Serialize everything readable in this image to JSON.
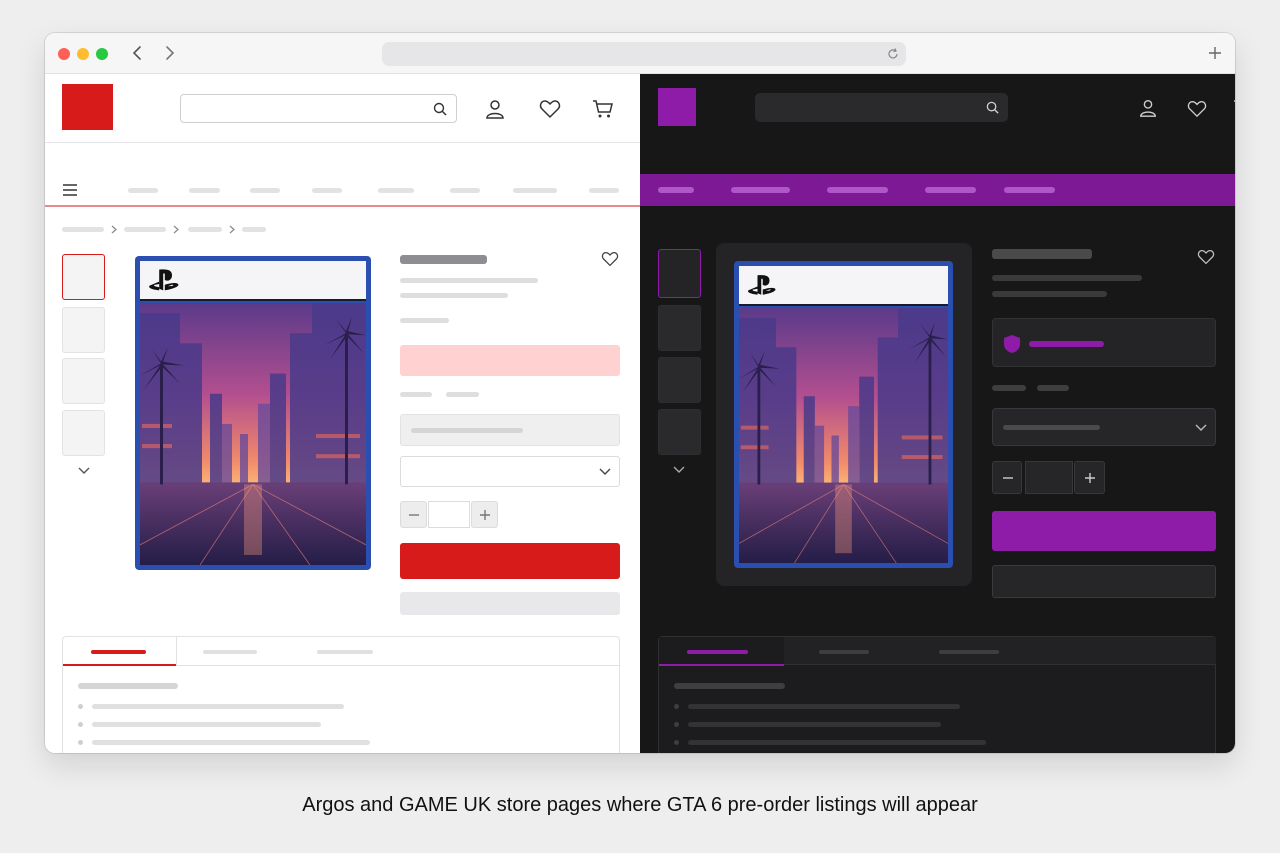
{
  "caption": "Argos and GAME UK store pages where GTA 6 pre-order listings will appear",
  "browser": {
    "window_controls": [
      "close",
      "minimize",
      "maximize"
    ],
    "icons": [
      "back-arrow-icon",
      "forward-arrow-icon",
      "reload-icon",
      "new-tab-icon"
    ]
  },
  "stores": {
    "argos": {
      "theme": "light",
      "accent": "#d71a1a",
      "header_icons": [
        "search-icon",
        "account-icon",
        "wishlist-heart-icon",
        "basket-icon"
      ],
      "nav_icon": "hamburger-menu-icon",
      "product_badge_icon": "playstation-logo-icon"
    },
    "game": {
      "theme": "dark",
      "accent": "#8e1ca8",
      "header_icons": [
        "search-icon",
        "account-icon",
        "wishlist-heart-icon",
        "basket-icon"
      ],
      "trust_icon": "shield-icon",
      "product_badge_icon": "playstation-logo-icon"
    }
  },
  "colors": {
    "argos_red": "#d71a1a",
    "argos_promo_pink": "#ffd1d1",
    "game_purple": "#8e1ca8",
    "case_blue": "#2a4fb0"
  }
}
